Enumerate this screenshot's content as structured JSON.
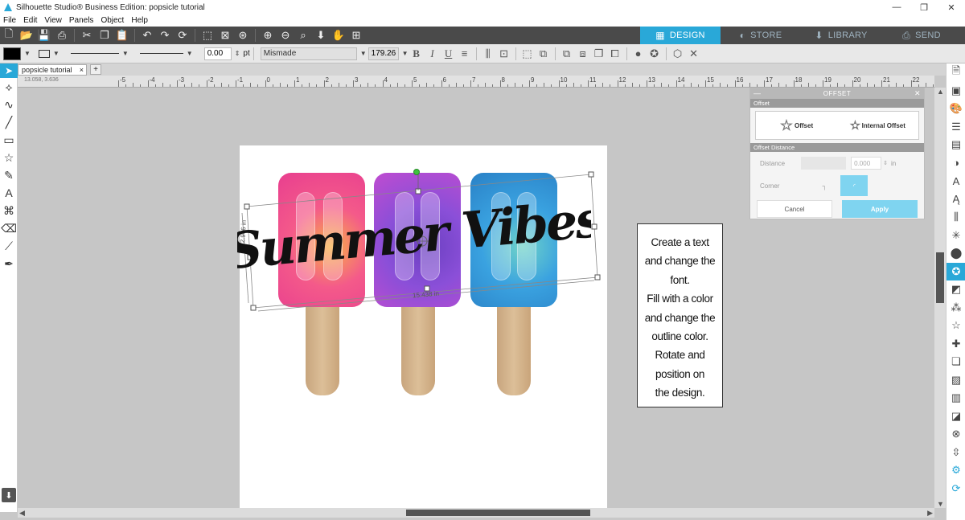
{
  "window": {
    "title": "Silhouette Studio® Business Edition: popsicle tutorial",
    "controls": [
      "—",
      "❐",
      "✕"
    ]
  },
  "menu": [
    "File",
    "Edit",
    "View",
    "Panels",
    "Object",
    "Help"
  ],
  "nav_tabs": [
    {
      "label": "DESIGN",
      "icon": "grid-icon",
      "glyph": "▦",
      "active": true
    },
    {
      "label": "STORE",
      "icon": "store-icon",
      "glyph": "◐",
      "active": false
    },
    {
      "label": "LIBRARY",
      "icon": "library-icon",
      "glyph": "⬇",
      "active": false
    },
    {
      "label": "SEND",
      "icon": "send-icon",
      "glyph": "⎙",
      "active": false
    }
  ],
  "text_toolbar": {
    "line_weight": "0.00",
    "line_unit": "pt",
    "font": "Mismade",
    "font_size": "179.26",
    "bold": "B",
    "italic": "I",
    "underline": "U"
  },
  "document_tab": {
    "name": "popsicle tutorial",
    "close": "×",
    "add": "+"
  },
  "ruler": {
    "labels": [
      "-5",
      "-4",
      "-3",
      "-2",
      "-1",
      "0",
      "1",
      "2",
      "3",
      "4",
      "5",
      "6",
      "7",
      "8",
      "9",
      "10",
      "11",
      "12",
      "13",
      "14",
      "15",
      "16",
      "17",
      "18",
      "19",
      "20",
      "21",
      "22"
    ],
    "coord": "13.058, 3.636"
  },
  "design": {
    "text": "Summer Vibes",
    "height_dim": "2.906 in",
    "width_dim": "15.438 in",
    "colors": {
      "pop1": [
        "#f45a8a",
        "#f7b047",
        "#e83e8f"
      ],
      "pop2": [
        "#8a4fd8",
        "#6a3fc0",
        "#c04cd0"
      ],
      "pop3": [
        "#3aa2e0",
        "#6fd3c8",
        "#2980c6"
      ]
    }
  },
  "instruction": [
    "Create a text",
    "and change the",
    "font.",
    "Fill with a color",
    "and change the",
    "outline color.",
    "Rotate and",
    "position on",
    "the design."
  ],
  "offset_panel": {
    "title": "OFFSET",
    "section_offset": "Offset",
    "btn_offset": "Offset",
    "btn_internal": "Internal Offset",
    "section_distance": "Offset Distance",
    "distance_label": "Distance",
    "distance_value": "0.000",
    "distance_unit": "in",
    "corner_label": "Corner",
    "cancel": "Cancel",
    "apply": "Apply"
  }
}
